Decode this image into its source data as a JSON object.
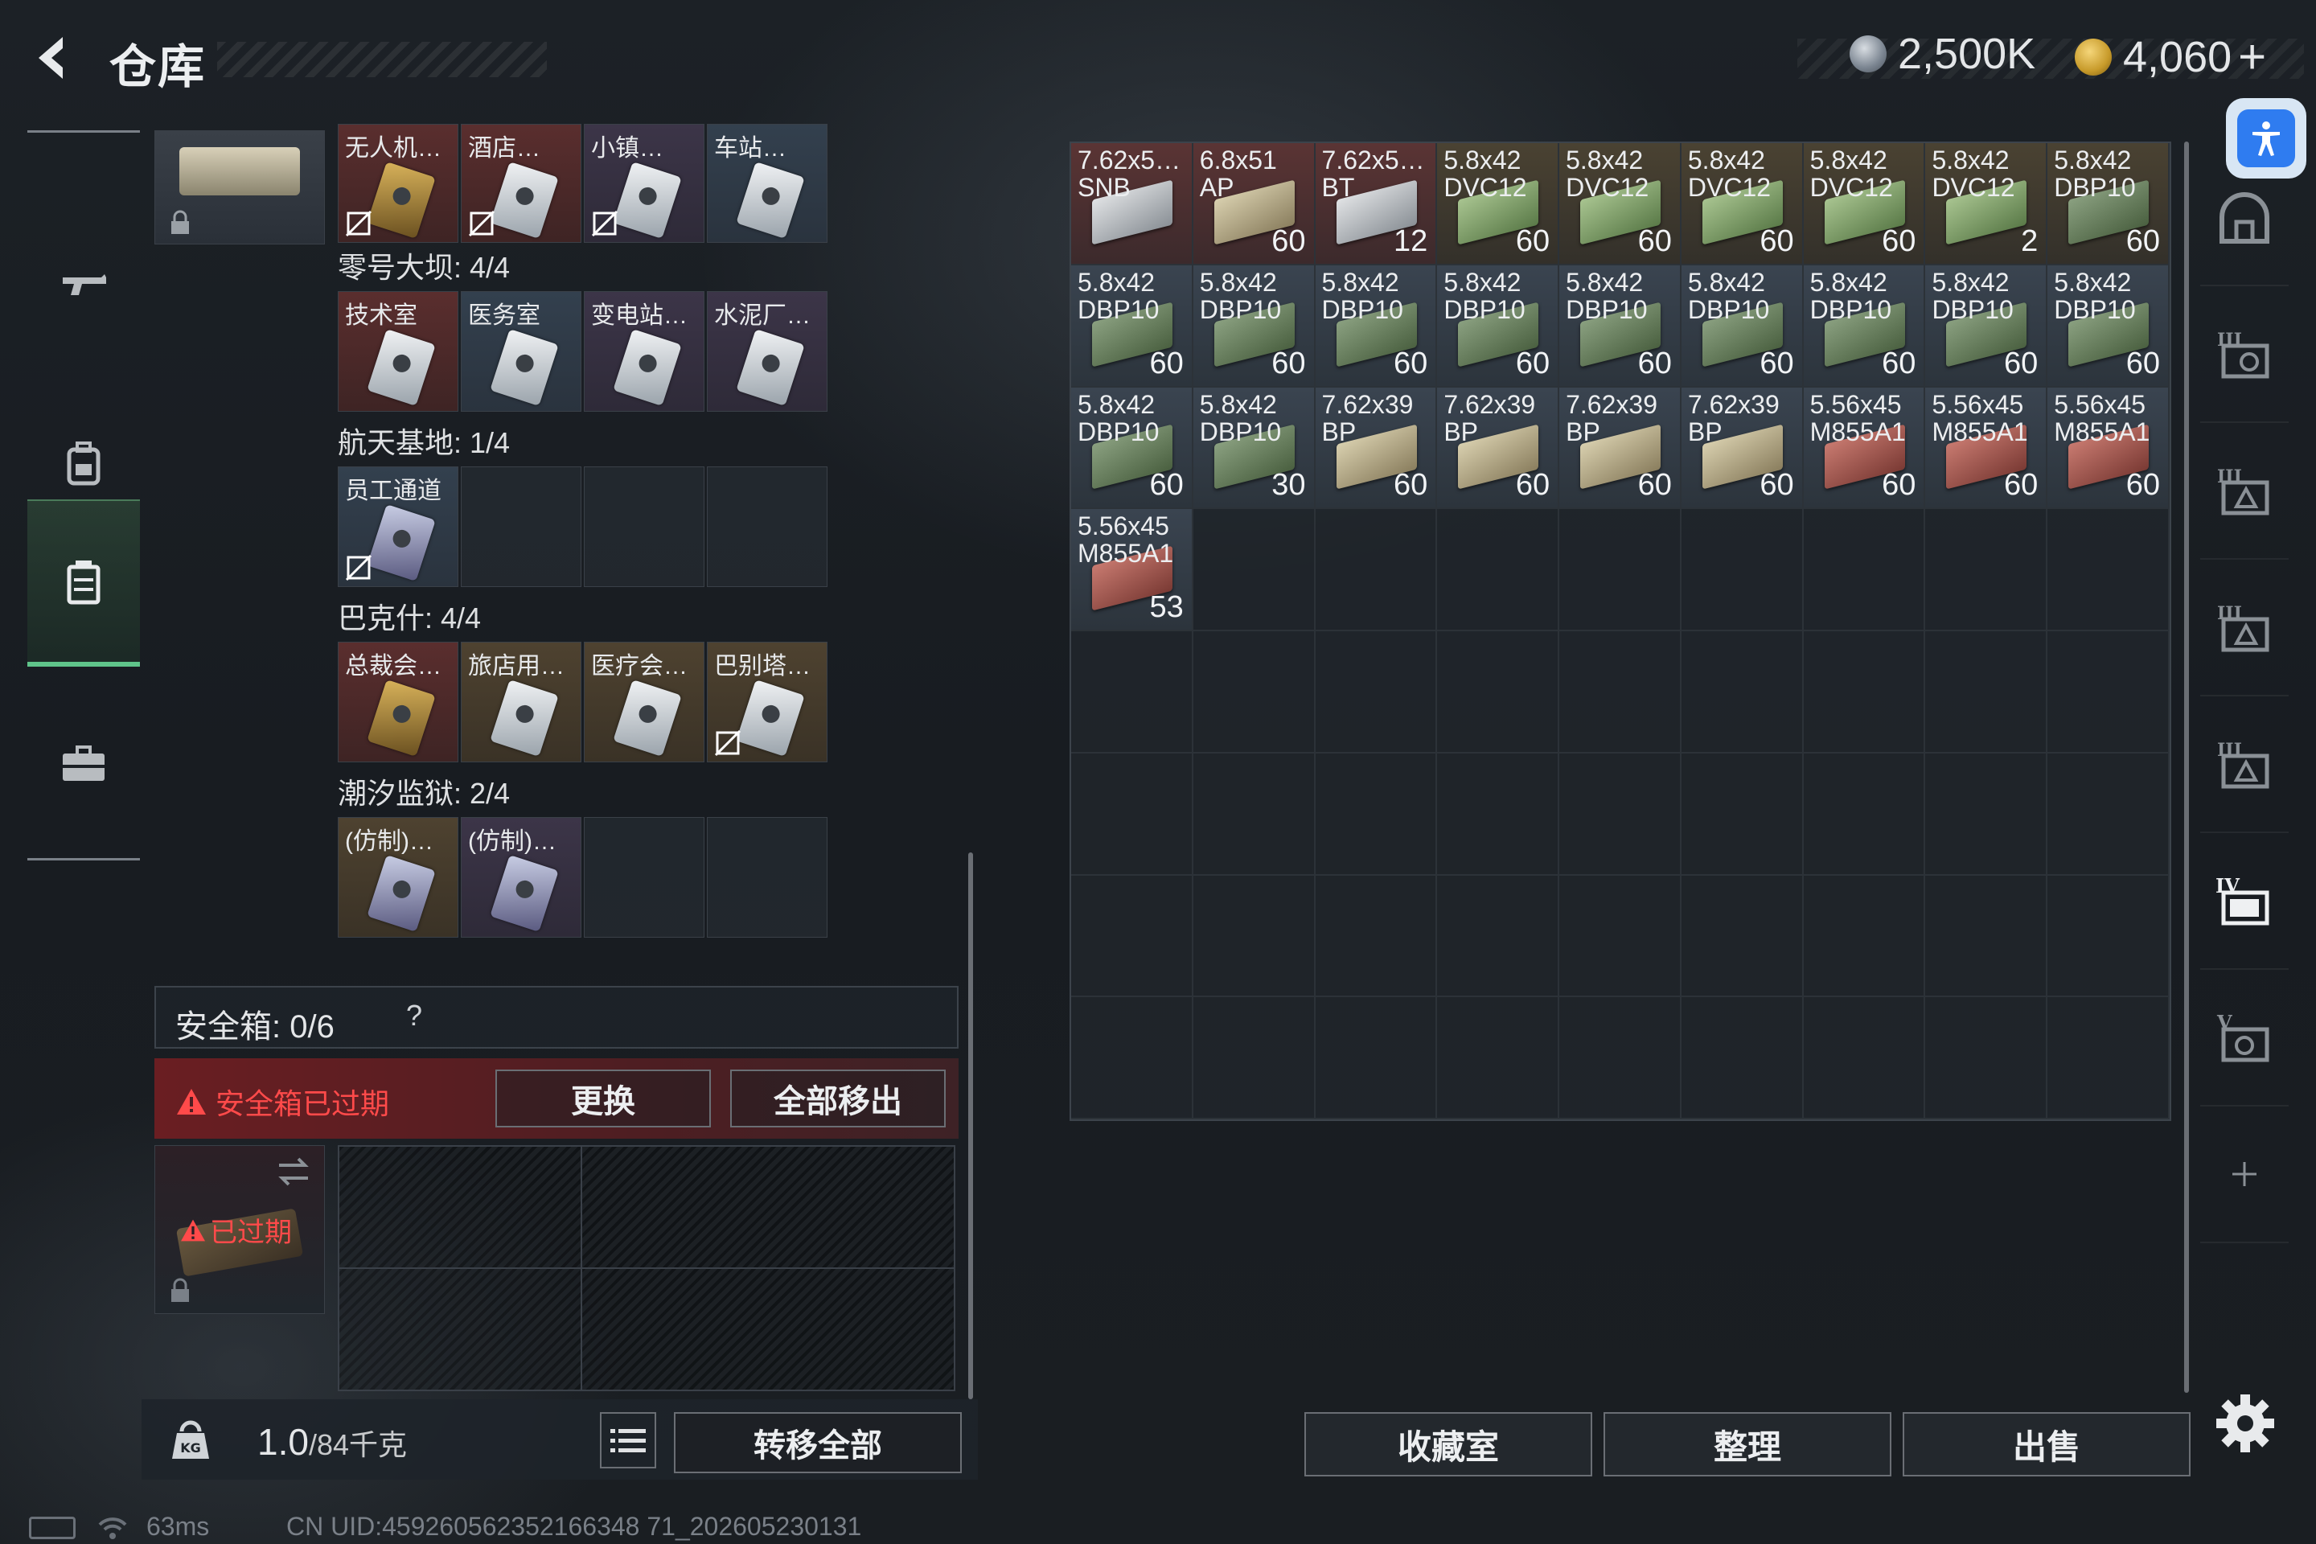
{
  "header": {
    "title": "仓库",
    "currencies": [
      {
        "icon": "silver-coin-icon",
        "value": "2,500K"
      },
      {
        "icon": "gold-coin-icon",
        "value": "4,060"
      }
    ],
    "plus": "+"
  },
  "left_nav": [
    "gun-icon",
    "backpack-icon",
    "vest-icon",
    "briefcase-icon"
  ],
  "key_panel": {
    "top_row_labels": [
      "无人机…",
      "酒店…",
      "小镇…",
      "车站…"
    ],
    "maps": [
      {
        "title": "零号大坝: 4/4",
        "slots": [
          "技术室",
          "医务室",
          "变电站…",
          "水泥厂…"
        ]
      },
      {
        "title": "航天基地: 1/4",
        "slots": [
          "员工通道",
          "",
          "",
          ""
        ]
      },
      {
        "title": "巴克什: 4/4",
        "slots": [
          "总裁会…",
          "旅店用…",
          "医疗会…",
          "巴别塔…"
        ]
      },
      {
        "title": "潮汐监狱: 2/4",
        "slots": [
          "(仿制)…",
          "(仿制)…",
          "",
          ""
        ]
      }
    ]
  },
  "safebox": {
    "label": "安全箱: 0/6",
    "help": "?",
    "expired_notice": "安全箱已过期",
    "replace_label": "更换",
    "move_all_label": "全部移出",
    "case_status": "已过期"
  },
  "weight": {
    "current": "1.0",
    "max": "/84千克"
  },
  "transfer_all_label": "转移全部",
  "inventory": [
    {
      "name": "7.62x5…\nSNB",
      "count": "",
      "color": "white",
      "bg": "red"
    },
    {
      "name": "6.8x51\nAP",
      "count": "60",
      "color": "khaki",
      "bg": "red"
    },
    {
      "name": "7.62x5…\nBT",
      "count": "12",
      "color": "white",
      "bg": "red"
    },
    {
      "name": "5.8x42\nDVC12",
      "count": "60",
      "color": "green",
      "bg": "gold"
    },
    {
      "name": "5.8x42\nDVC12",
      "count": "60",
      "color": "green",
      "bg": "gold"
    },
    {
      "name": "5.8x42\nDVC12",
      "count": "60",
      "color": "green",
      "bg": "gold"
    },
    {
      "name": "5.8x42\nDVC12",
      "count": "60",
      "color": "green",
      "bg": "gold"
    },
    {
      "name": "5.8x42\nDVC12",
      "count": "2",
      "color": "green",
      "bg": "gold"
    },
    {
      "name": "5.8x42\nDBP10",
      "count": "60",
      "color": "darkgreen",
      "bg": "gold"
    },
    {
      "name": "5.8x42\nDBP10",
      "count": "60",
      "color": "darkgreen",
      "bg": "blue"
    },
    {
      "name": "5.8x42\nDBP10",
      "count": "60",
      "color": "darkgreen",
      "bg": "blue"
    },
    {
      "name": "5.8x42\nDBP10",
      "count": "60",
      "color": "darkgreen",
      "bg": "blue"
    },
    {
      "name": "5.8x42\nDBP10",
      "count": "60",
      "color": "darkgreen",
      "bg": "blue"
    },
    {
      "name": "5.8x42\nDBP10",
      "count": "60",
      "color": "darkgreen",
      "bg": "blue"
    },
    {
      "name": "5.8x42\nDBP10",
      "count": "60",
      "color": "darkgreen",
      "bg": "blue"
    },
    {
      "name": "5.8x42\nDBP10",
      "count": "60",
      "color": "darkgreen",
      "bg": "blue"
    },
    {
      "name": "5.8x42\nDBP10",
      "count": "60",
      "color": "darkgreen",
      "bg": "blue"
    },
    {
      "name": "5.8x42\nDBP10",
      "count": "60",
      "color": "darkgreen",
      "bg": "blue"
    },
    {
      "name": "5.8x42\nDBP10",
      "count": "60",
      "color": "darkgreen",
      "bg": "blue"
    },
    {
      "name": "5.8x42\nDBP10",
      "count": "30",
      "color": "darkgreen",
      "bg": "blue"
    },
    {
      "name": "7.62x39\nBP",
      "count": "60",
      "color": "khaki",
      "bg": "blue"
    },
    {
      "name": "7.62x39\nBP",
      "count": "60",
      "color": "khaki",
      "bg": "blue"
    },
    {
      "name": "7.62x39\nBP",
      "count": "60",
      "color": "khaki",
      "bg": "blue"
    },
    {
      "name": "7.62x39\nBP",
      "count": "60",
      "color": "khaki",
      "bg": "blue"
    },
    {
      "name": "5.56x45\nM855A1",
      "count": "60",
      "color": "red",
      "bg": "blue"
    },
    {
      "name": "5.56x45\nM855A1",
      "count": "60",
      "color": "red",
      "bg": "blue"
    },
    {
      "name": "5.56x45\nM855A1",
      "count": "60",
      "color": "red",
      "bg": "blue"
    },
    {
      "name": "5.56x45\nM855A1",
      "count": "53",
      "color": "red",
      "bg": "blue"
    }
  ],
  "bottom_buttons": {
    "collection": "收藏室",
    "sort": "整理",
    "sell": "出售"
  },
  "right_nav": [
    "home-stash-icon",
    "stash-tab-2-icon",
    "stash-tab-3-icon",
    "stash-tab-4-icon",
    "stash-tab-5-icon",
    "stash-tab-6-icon",
    "stash-tab-7-icon",
    "add-tab-icon"
  ],
  "status_bar": {
    "ping": "63ms",
    "uid": "CN UID:459260562352166348 71_202605230131"
  }
}
